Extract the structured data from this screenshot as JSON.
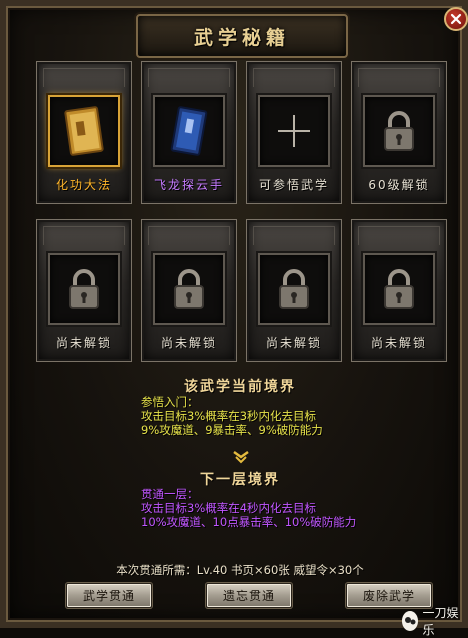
{
  "window": {
    "title": "武学秘籍"
  },
  "slots": [
    {
      "label": "化功大法",
      "state": "learned-selected",
      "icon": "gold-book-icon"
    },
    {
      "label": "飞龙探云手",
      "state": "learned",
      "icon": "blue-book-icon"
    },
    {
      "label": "可参悟武学",
      "state": "available",
      "icon": "plus-icon"
    },
    {
      "label": "60级解锁",
      "state": "locked",
      "icon": "padlock-icon"
    },
    {
      "label": "尚未解锁",
      "state": "locked",
      "icon": "padlock-icon"
    },
    {
      "label": "尚未解锁",
      "state": "locked",
      "icon": "padlock-icon"
    },
    {
      "label": "尚未解锁",
      "state": "locked",
      "icon": "padlock-icon"
    },
    {
      "label": "尚未解锁",
      "state": "locked",
      "icon": "padlock-icon"
    }
  ],
  "current_realm": {
    "heading": "该武学当前境界",
    "level": "参悟入门：",
    "effect": "攻击目标3%概率在3秒内化去目标",
    "stats": "9%攻魔道、9暴击率、9%破防能力"
  },
  "next_realm": {
    "heading": "下一层境界",
    "level": "贯通一层：",
    "effect": "攻击目标3%概率在4秒内化去目标",
    "stats": "10%攻魔道、10点暴击率、10%破防能力"
  },
  "requirement": "本次贯通所需：Lv.40  书页×60张  威望令×30个",
  "buttons": {
    "mastery": "武学贯通",
    "forget": "遗忘贯通",
    "remove": "废除武学"
  },
  "watermark": "一刀娱乐",
  "colors": {
    "gold": "#e7cf93",
    "current_text": "#e6e24a",
    "next_text": "#c056ff",
    "selected_label": "#ffb52a",
    "second_label": "#c57bff"
  }
}
